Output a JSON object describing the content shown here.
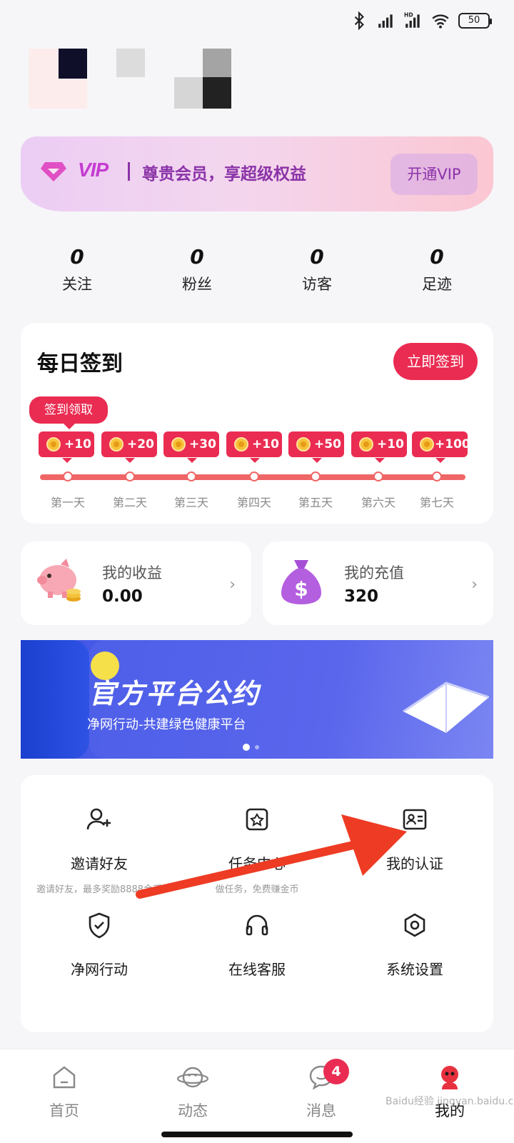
{
  "status_bar": {
    "battery": "50",
    "icons": [
      "bluetooth-icon",
      "signal-icon",
      "hd-signal-icon",
      "wifi-icon",
      "battery-icon"
    ]
  },
  "vip": {
    "logo": "VIP",
    "text": "尊贵会员，享超级权益",
    "button": "开通VIP",
    "accent": "#8b33a8"
  },
  "stats": [
    {
      "value": "0",
      "label": "关注"
    },
    {
      "value": "0",
      "label": "粉丝"
    },
    {
      "value": "0",
      "label": "访客"
    },
    {
      "value": "0",
      "label": "足迹"
    }
  ],
  "checkin": {
    "title": "每日签到",
    "button": "立即签到",
    "claim_tip": "签到领取",
    "rewards": [
      "+10",
      "+20",
      "+30",
      "+10",
      "+50",
      "+10",
      "+100"
    ],
    "days": [
      "第一天",
      "第二天",
      "第三天",
      "第四天",
      "第五天",
      "第六天",
      "第七天"
    ],
    "accent": "#ea2c52"
  },
  "wallet": {
    "earnings": {
      "label": "我的收益",
      "value": "0.00"
    },
    "recharge": {
      "label": "我的充值",
      "value": "320"
    }
  },
  "notice": {
    "title": "官方平台公约",
    "subtitle": "净网行动-共建绿色健康平台"
  },
  "menu": {
    "invite": {
      "label": "邀请好友",
      "desc": "邀请好友，最多奖励8888金币"
    },
    "tasks": {
      "label": "任务中心",
      "desc": "做任务，免费赚金币"
    },
    "verify": {
      "label": "我的认证"
    },
    "clean_net": {
      "label": "净网行动"
    },
    "support": {
      "label": "在线客服"
    },
    "settings": {
      "label": "系统设置"
    }
  },
  "tabbar": {
    "home": "首页",
    "feed": "动态",
    "messages": "消息",
    "messages_badge": "4",
    "me": "我的"
  },
  "watermark": "Baidu经验 jingyan.baidu.com"
}
